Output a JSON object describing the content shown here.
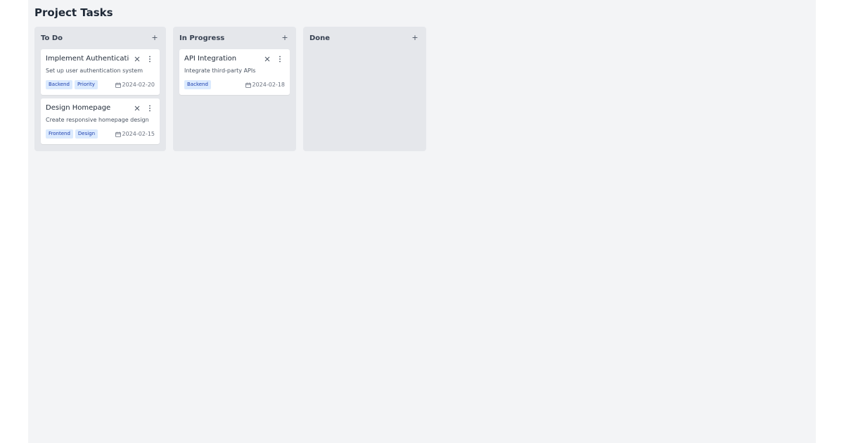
{
  "page": {
    "title": "Project Tasks"
  },
  "columns": [
    {
      "title": "To Do",
      "add_label": "+",
      "cards": [
        {
          "title": "Implement Authentication",
          "description": "Set up user authentication system",
          "tags": [
            "Backend",
            "Priority"
          ],
          "due": "2024-02-20",
          "close_icon": "close-icon",
          "menu_icon": "more-vertical-icon"
        },
        {
          "title": "Design Homepage",
          "description": "Create responsive homepage design",
          "tags": [
            "Frontend",
            "Design"
          ],
          "due": "2024-02-15",
          "close_icon": "close-icon",
          "menu_icon": "more-vertical-icon"
        }
      ]
    },
    {
      "title": "In Progress",
      "add_label": "+",
      "cards": [
        {
          "title": "API Integration",
          "description": "Integrate third-party APIs",
          "tags": [
            "Backend"
          ],
          "due": "2024-02-18",
          "close_icon": "close-icon",
          "menu_icon": "more-vertical-icon"
        }
      ]
    },
    {
      "title": "Done",
      "add_label": "+",
      "cards": []
    }
  ],
  "colors": {
    "board_bg": "#f3f4f6",
    "column_bg": "#e5e7eb",
    "card_bg": "#ffffff",
    "tag_bg": "#dbeafe",
    "tag_text": "#1e40af",
    "title_text": "#1f2937"
  },
  "icons": {
    "add": "plus-icon",
    "due": "calendar-icon"
  }
}
